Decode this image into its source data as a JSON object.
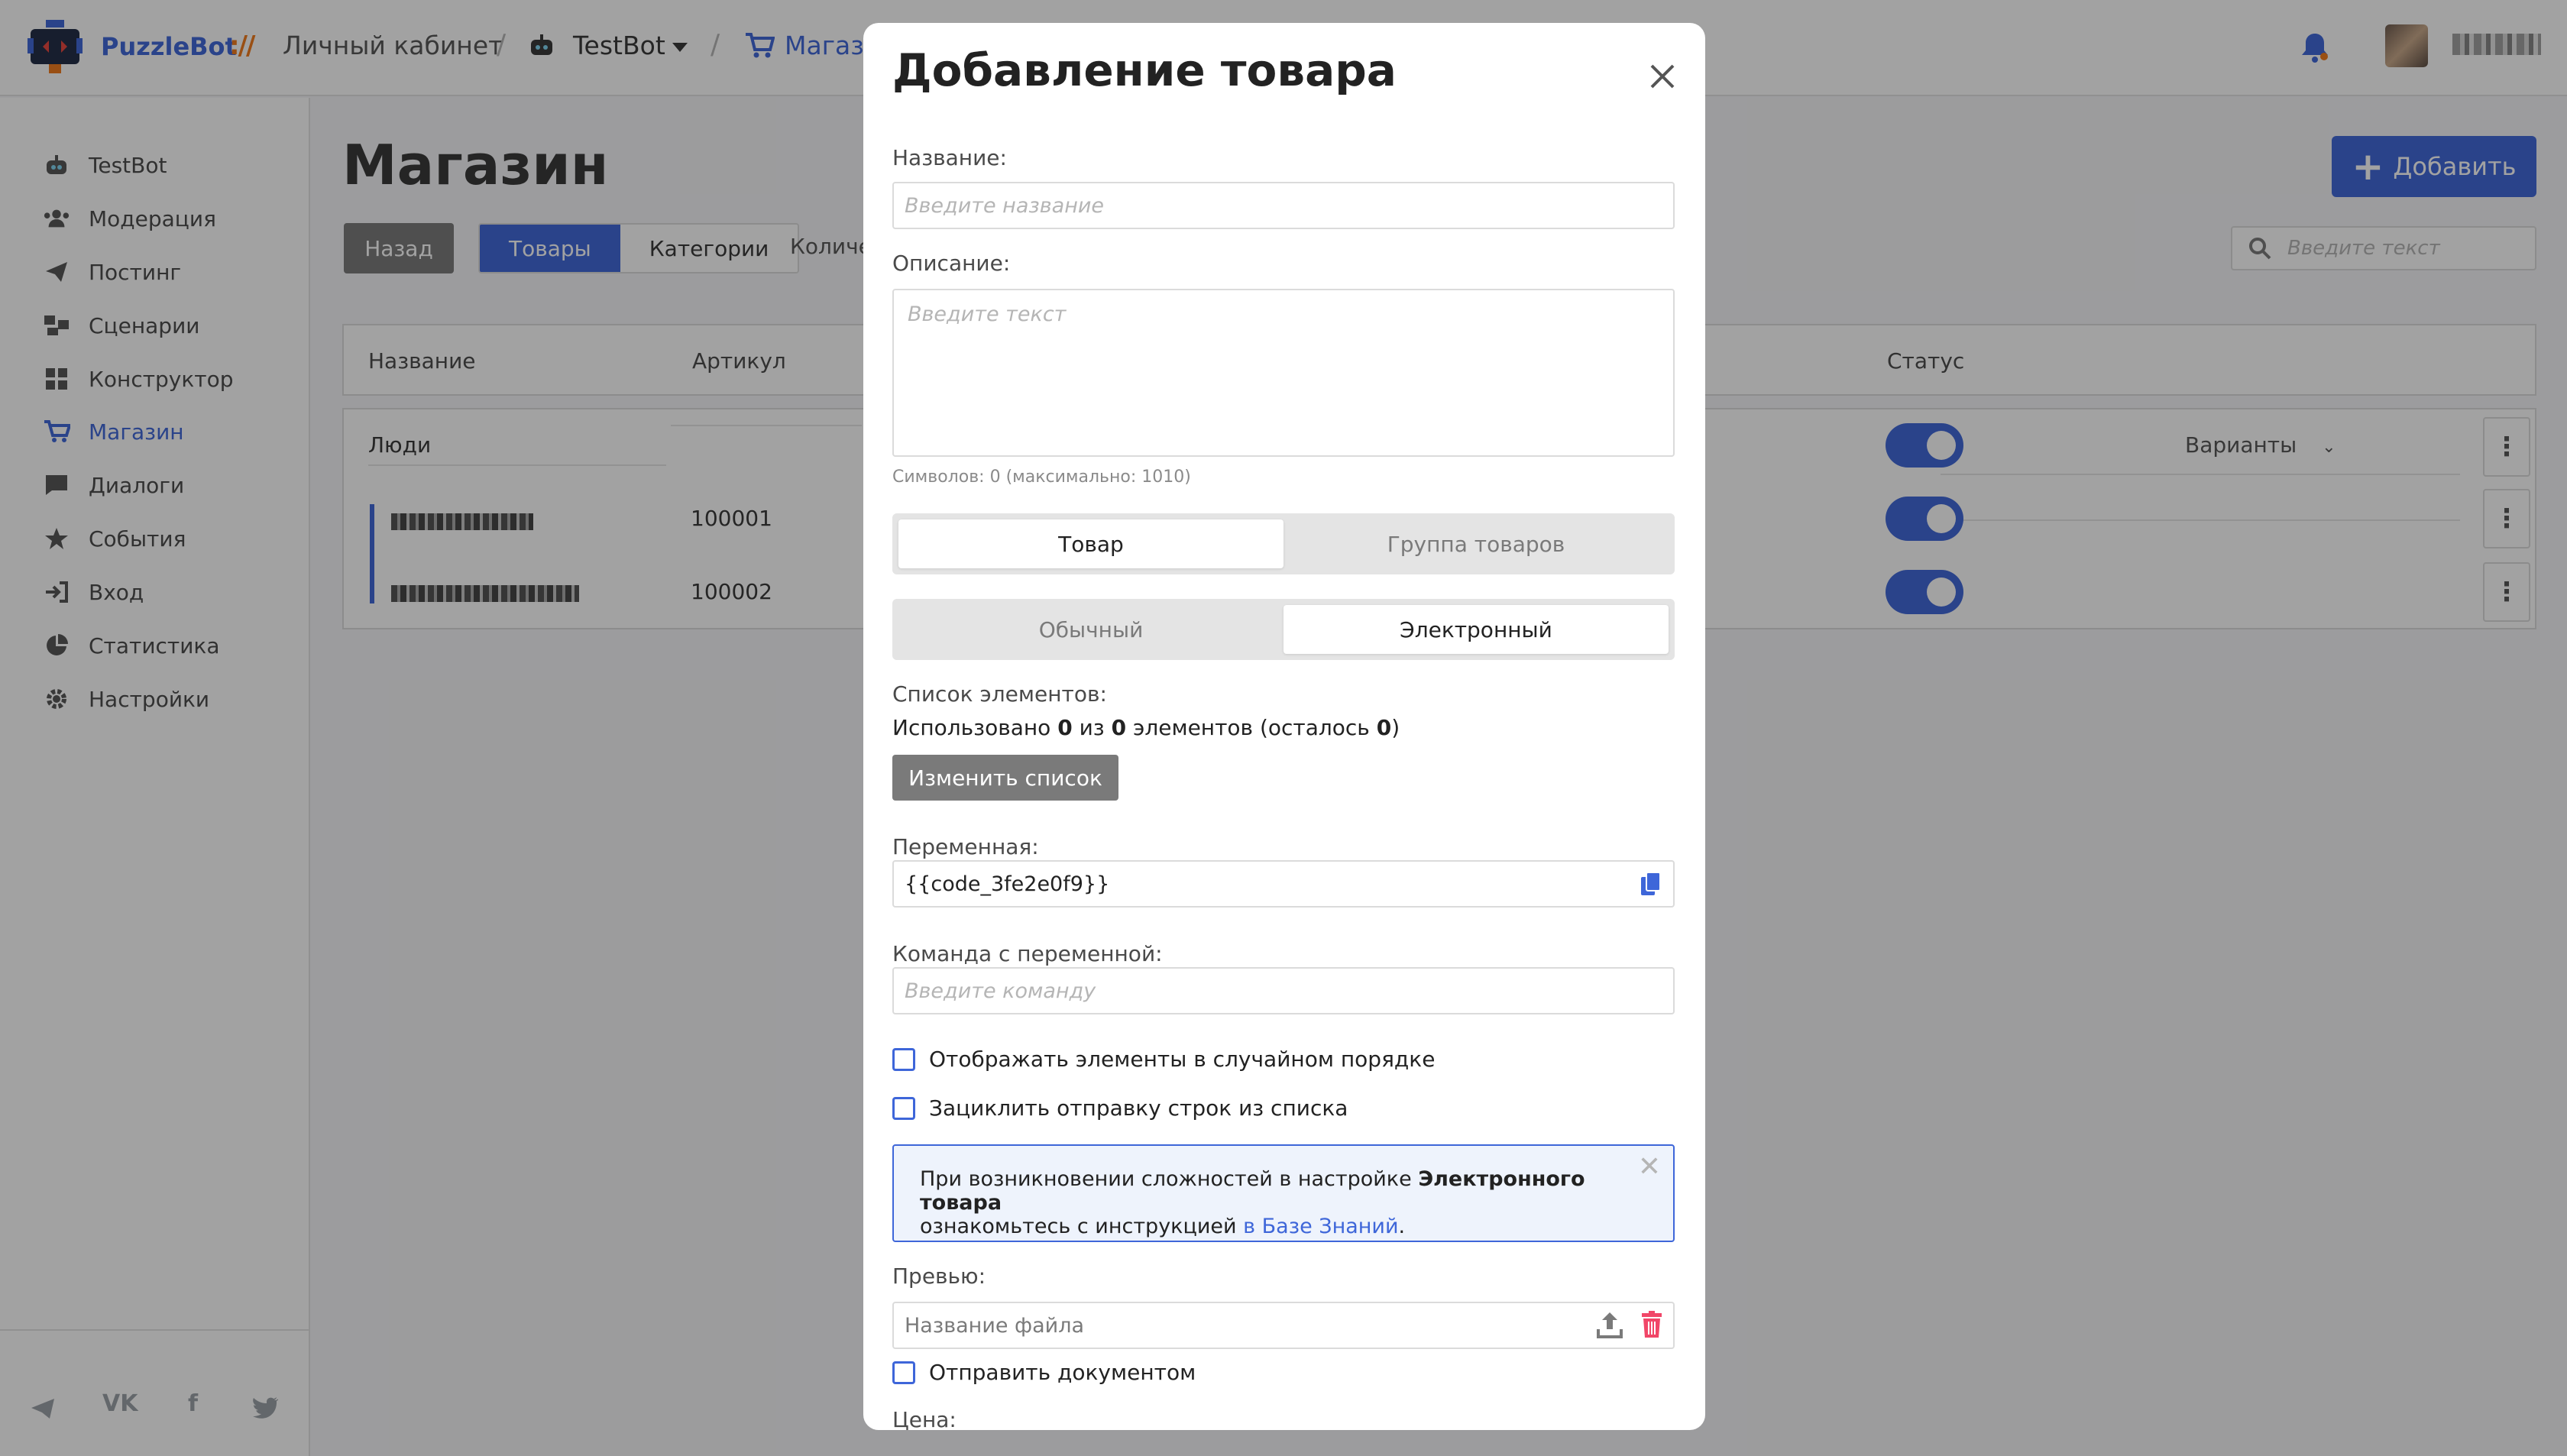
{
  "topbar": {
    "brand": "PuzzleBot",
    "brand_sep": "://",
    "account_crumb": "Личный кабинет",
    "bot_crumb": "TestBot",
    "shop_crumb": "Магазин"
  },
  "sidebar": {
    "items": [
      {
        "label": "TestBot",
        "icon": "bot-icon"
      },
      {
        "label": "Модерация",
        "icon": "users-icon"
      },
      {
        "label": "Постинг",
        "icon": "paper-plane-icon"
      },
      {
        "label": "Сценарии",
        "icon": "scenario-icon"
      },
      {
        "label": "Конструктор",
        "icon": "grid-icon"
      },
      {
        "label": "Магазин",
        "icon": "cart-icon"
      },
      {
        "label": "Диалоги",
        "icon": "chat-icon"
      },
      {
        "label": "События",
        "icon": "star-icon"
      },
      {
        "label": "Вход",
        "icon": "sign-in-icon"
      },
      {
        "label": "Статистика",
        "icon": "pie-chart-icon"
      },
      {
        "label": "Настройки",
        "icon": "gear-icon"
      }
    ],
    "social": [
      "telegram-icon",
      "vk-icon",
      "facebook-icon",
      "twitter-icon"
    ]
  },
  "main": {
    "title": "Магазин",
    "add_button": "Добавить",
    "back_button": "Назад",
    "tabs": [
      "Товары",
      "Категории"
    ],
    "count_label": "Количе",
    "search_placeholder": "Введите текст",
    "table": {
      "headers": {
        "name": "Название",
        "sku": "Артикул",
        "status": "Статус"
      },
      "group_row": {
        "name": "Люди",
        "variants": "Варианты"
      },
      "rows": [
        {
          "sku": "100001",
          "status_on": true
        },
        {
          "sku": "100002",
          "status_on": true
        }
      ]
    }
  },
  "modal": {
    "title": "Добавление товара",
    "name_label": "Название:",
    "name_placeholder": "Введите название",
    "desc_label": "Описание:",
    "desc_placeholder": "Введите текст",
    "desc_hint": "Символов: 0 (максимально: 1010)",
    "type_options": [
      "Товар",
      "Группа товаров"
    ],
    "type_selected": "Товар",
    "kind_options": [
      "Обычный",
      "Электронный"
    ],
    "kind_selected": "Электронный",
    "list_label": "Список элементов:",
    "usage": {
      "prefix": "Использовано ",
      "used": "0",
      "mid": " из ",
      "total": "0",
      "suffix": " элементов (осталось ",
      "left": "0",
      "end": ")"
    },
    "edit_list_button": "Изменить список",
    "variable_label": "Переменная:",
    "variable_value": "{{code_3fe2e0f9}}",
    "command_label": "Команда с переменной:",
    "command_placeholder": "Введите команду",
    "checkbox_random": "Отображать элементы в случайном порядке",
    "checkbox_loop": "Зациклить отправку строк из списка",
    "notice": {
      "part1": "При возникновении сложностей в настройке ",
      "bold": "Электронного товара",
      "part2": "ознакомьтесь с инструкцией ",
      "link": "в Базе Знаний",
      "end": "."
    },
    "preview_label": "Превью:",
    "file_placeholder": "Название файла",
    "checkbox_document": "Отправить документом",
    "price_label": "Цена:"
  },
  "colors": {
    "accent": "#3e66d9",
    "brand_orange": "#f07a1a",
    "danger": "#f14668",
    "muted_button": "#7a7a7a"
  }
}
